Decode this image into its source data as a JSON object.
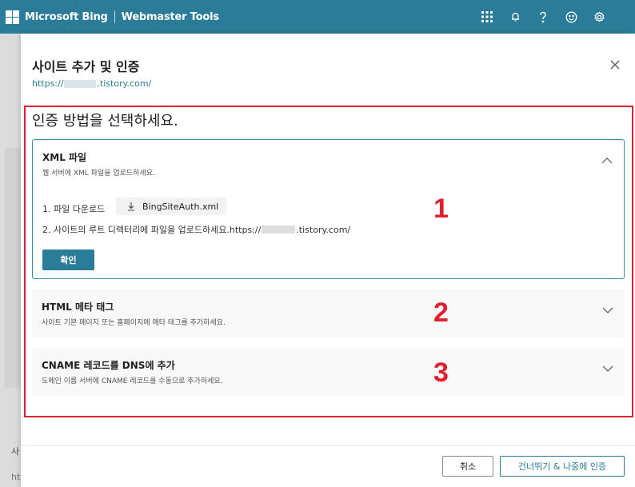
{
  "topbar": {
    "brand": "Microsoft Bing",
    "product": "Webmaster Tools",
    "icons": [
      "apps-grid-icon",
      "bell-icon",
      "help-icon",
      "feedback-smile-icon",
      "settings-gear-icon"
    ],
    "bg_color": "#2b7c98"
  },
  "background": {
    "text1": "사",
    "text2": "ht"
  },
  "panel": {
    "title": "사이트 추가 및 인증",
    "url_prefix": "https://",
    "url_suffix": ".tistory.com/",
    "heading": "인증 방법을 선택하세요.",
    "methods": [
      {
        "title": "XML 파일",
        "description": "웹 서버에 XML 파일을 업로드하세요.",
        "step1_label": "1. 파일 다운로드",
        "download_label": "BingSiteAuth.xml",
        "step2_label": "2. 사이트의 루트 디렉터리에 파일을 업로드하세요.",
        "step2_url_prefix": "https://",
        "step2_url_suffix": ".tistory.com/",
        "confirm_label": "확인",
        "number": "1"
      },
      {
        "title": "HTML 메타 태그",
        "description": "사이트 기본 페이지 또는 홈페이지에 메타 태그를 추가하세요.",
        "number": "2"
      },
      {
        "title": "CNAME 레코드를 DNS에 추가",
        "description": "도메인 이름 서버에 CNAME 레코드를 수동으로 추가하세요.",
        "number": "3"
      }
    ],
    "cancel_label": "취소",
    "skip_label": "건너뛰기 & 나중에 인증"
  },
  "colors": {
    "accent": "#2b7c98",
    "annotation_red": "#e0202c"
  }
}
